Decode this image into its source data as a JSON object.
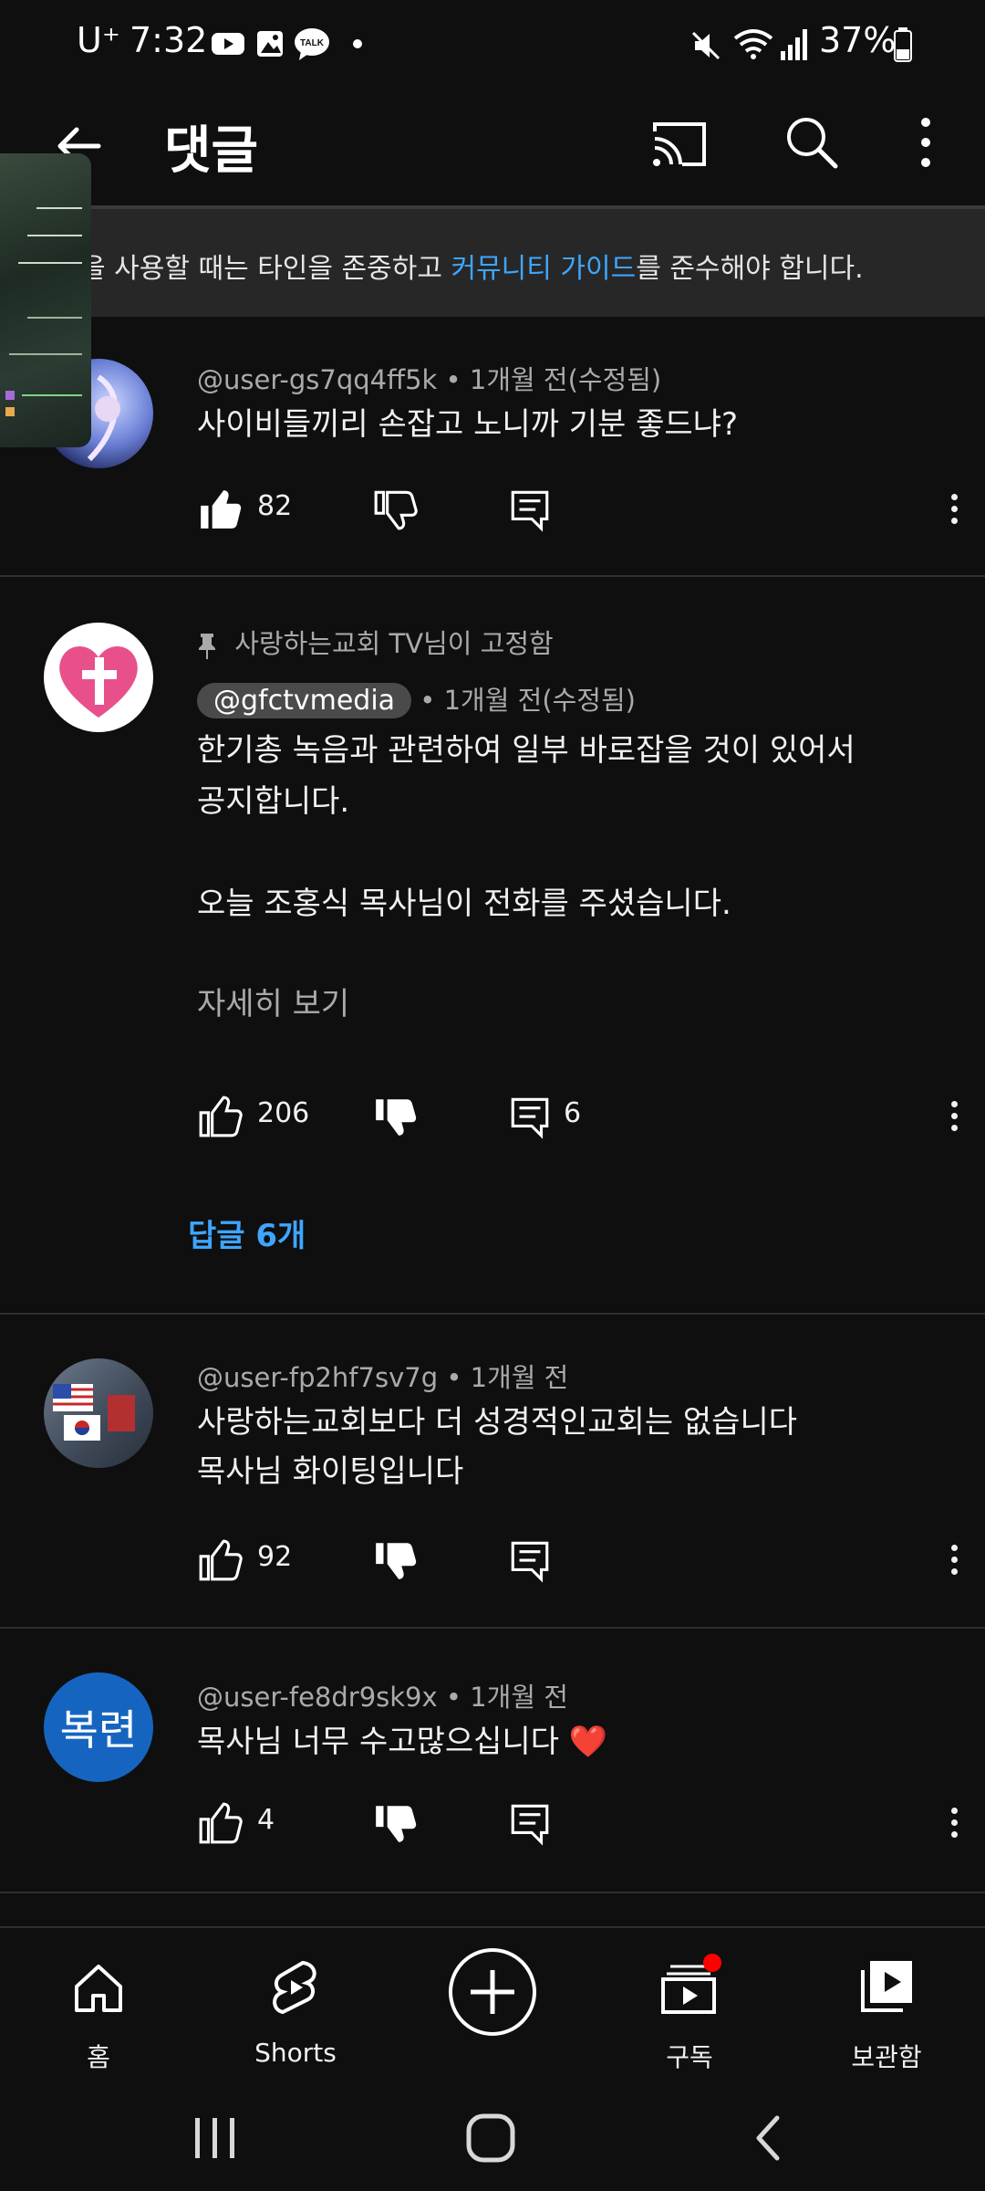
{
  "status_bar": {
    "carrier": "U⁺",
    "time": "7:32",
    "battery": "37%"
  },
  "header": {
    "title": "댓글"
  },
  "banner": {
    "text_before": "을 사용할 때는 타인을 존중하고 ",
    "link": "커뮤니티 가이드",
    "text_after": "를 준수해야 합니다."
  },
  "comments": [
    {
      "author": "@user-gs7qq4ff5k",
      "time": "• 1개월 전(수정됨)",
      "lines": [
        "사이비들끼리 손잡고 노니까 기분 좋드냐?"
      ],
      "likes": "82",
      "replies": ""
    },
    {
      "pinned_by": "사랑하는교회 TV님이 고정함",
      "author": "@gfctvmedia",
      "time": "• 1개월 전(수정됨)",
      "lines": [
        "한기총 녹음과 관련하여 일부 바로잡을 것이 있어서",
        "공지합니다.",
        "",
        "오늘 조홍식 목사님이 전화를 주셨습니다."
      ],
      "read_more": "자세히 보기",
      "likes": "206",
      "replies": "6",
      "reply_link": "답글 6개"
    },
    {
      "author": "@user-fp2hf7sv7g",
      "time": "• 1개월 전",
      "lines": [
        "사랑하는교회보다 더 성경적인교회는 없습니다",
        "목사님 화이팅입니다"
      ],
      "likes": "92",
      "replies": ""
    },
    {
      "author": "@user-fe8dr9sk9x",
      "time": "• 1개월 전",
      "avatar_text": "복련",
      "lines": [
        "목사님 너무  수고많으십니다 ❤️"
      ],
      "likes": "4",
      "replies": ""
    }
  ],
  "bottom_nav": {
    "home": "홈",
    "shorts": "Shorts",
    "subscriptions": "구독",
    "library": "보관함"
  },
  "colors": {
    "background": "#0f0f0f",
    "link_blue": "#3ea6ff",
    "pin_avatar_pink": "#e8508c",
    "avatar_blue": "#1565c0",
    "notification_red": "#ff0000"
  }
}
